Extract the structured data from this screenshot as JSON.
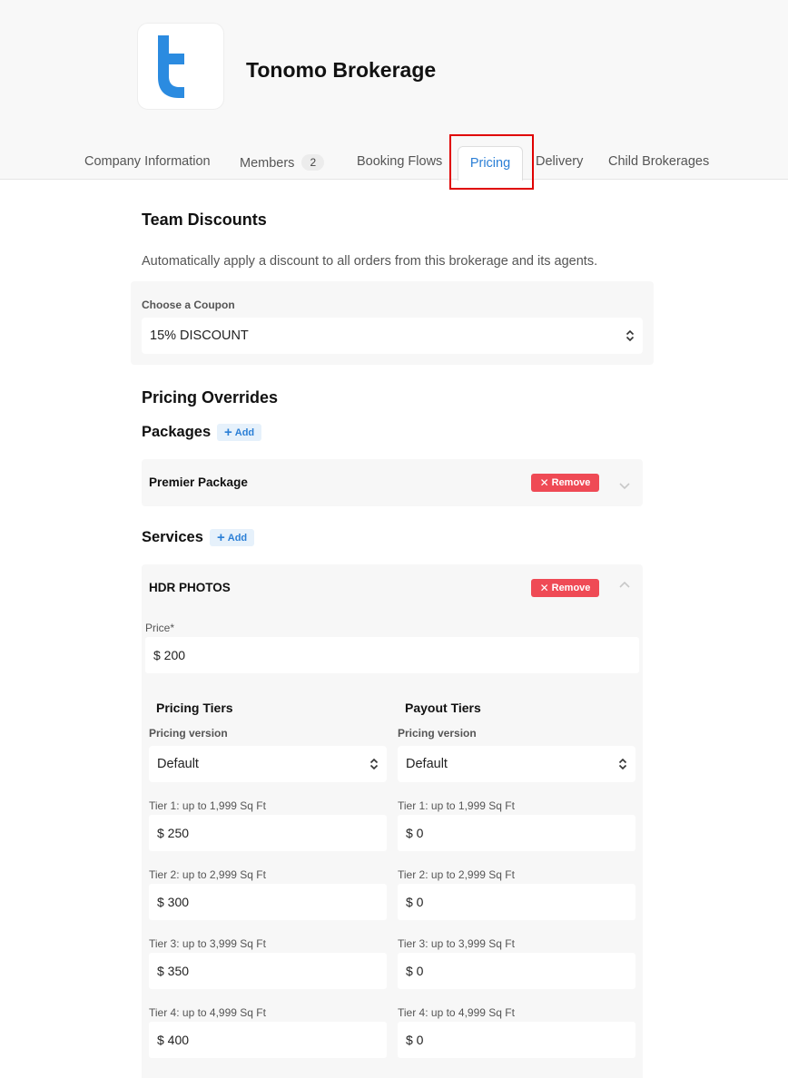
{
  "header": {
    "company_name": "Tonomo Brokerage",
    "logo_letter": "t",
    "brand_color": "#2b8be0"
  },
  "tabs": [
    {
      "label": "Company Information"
    },
    {
      "label": "Members",
      "count": "2"
    },
    {
      "label": "Booking Flows"
    },
    {
      "label": "Pricing",
      "active": true
    },
    {
      "label": "Delivery"
    },
    {
      "label": "Child Brokerages"
    }
  ],
  "team_discounts": {
    "title": "Team Discounts",
    "description": "Automatically apply a discount to all orders from this brokerage and its agents.",
    "coupon_label": "Choose a Coupon",
    "coupon_value": "15% DISCOUNT"
  },
  "pricing_overrides": {
    "title": "Pricing Overrides",
    "packages_label": "Packages",
    "services_label": "Services",
    "add_label": "Add",
    "remove_label": "Remove",
    "package_item": "Premier Package",
    "service_item": "HDR PHOTOS",
    "price_label": "Price*",
    "price_value": "$ 200"
  },
  "tiers": {
    "pricing_title": "Pricing Tiers",
    "payout_title": "Payout Tiers",
    "version_label": "Pricing version",
    "pricing_version": "Default",
    "payout_version": "Default",
    "rows": [
      {
        "label": "Tier 1: up to 1,999 Sq Ft",
        "price": "$ 250",
        "payout": "$ 0"
      },
      {
        "label": "Tier 2: up to 2,999 Sq Ft",
        "price": "$ 300",
        "payout": "$ 0"
      },
      {
        "label": "Tier 3: up to 3,999 Sq Ft",
        "price": "$ 350",
        "payout": "$ 0"
      },
      {
        "label": "Tier 4: up to 4,999 Sq Ft",
        "price": "$ 400",
        "payout": "$ 0"
      }
    ]
  }
}
